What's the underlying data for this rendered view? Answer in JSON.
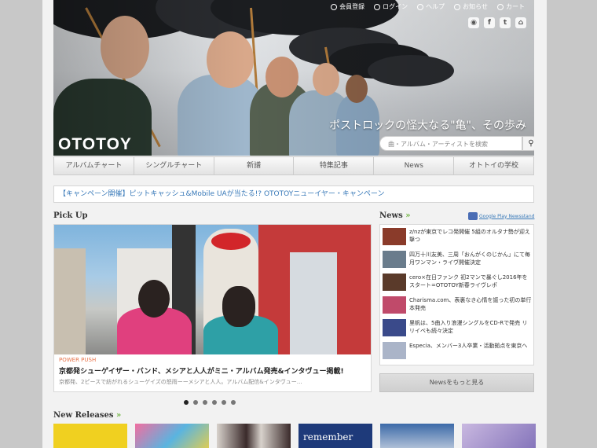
{
  "topnav": [
    {
      "label": "会員登録",
      "icon": "user-icon"
    },
    {
      "label": "ログイン",
      "icon": "login-icon"
    },
    {
      "label": "ヘルプ",
      "icon": "help-icon"
    },
    {
      "label": "お知らせ",
      "icon": "info-icon"
    },
    {
      "label": "カート",
      "icon": "cart-icon"
    }
  ],
  "social_icons": [
    "rss-icon",
    "facebook-icon",
    "twitter-icon",
    "home-icon"
  ],
  "hero": {
    "logo": "OTOTOY",
    "tagline": "ポストロックの怪大なる\"亀\"、その歩み",
    "search_placeholder": "曲・アルバム・アーティストを検索"
  },
  "mainnav": [
    "アルバムチャート",
    "シングルチャート",
    "新譜",
    "特集記事",
    "News",
    "オトトイの学校"
  ],
  "campaign": "【キャンペーン開催】ピットキャッシュ&Mobile UAが当たる!? OTOTOYニューイヤー・キャンペーン",
  "pickup": {
    "heading": "Pick Up",
    "label": "POWER PUSH",
    "title": "京都発シューゲイザー・バンド、メシアと人人がミニ・アルバム発売&インタヴュー掲載!",
    "desc": "京都発、2ピースで紡がれるシューゲイズの怒雨ーーメシアと人人。アルバム配信&インタヴュー…",
    "slides": 6,
    "active_slide": 1
  },
  "news": {
    "heading": "News",
    "badge": "Google Play Newsstand",
    "more": "Newsをもっと見る",
    "items": [
      {
        "text": "z/nzが東京でレコ発開催 5組のオルタナ勢が迎え撃つ",
        "color": "#8a3b2a"
      },
      {
        "text": "四万十川友美、三周「おんがくのじかん」にて毎月ワンマン・ライヴ開催決定",
        "color": "#6a7c8c"
      },
      {
        "text": "cero×在日ファンク 初2マンで暴ぐし2016年をスタート=OTOTOY新春ライヴレポ",
        "color": "#5a3a2a"
      },
      {
        "text": "Charisma.com、表裏なき心情を謳った初の単行本発売",
        "color": "#c04a6a"
      },
      {
        "text": "里帆は、5曲入り浪漫シングルをCD-Rで発売 リリイベも続々決定",
        "color": "#3a4a8a"
      },
      {
        "text": "Especia、メンバー3人卒業・活動拠点を東京へ",
        "color": "#aab4c8"
      }
    ]
  },
  "releases": {
    "heading": "New Releases",
    "thumbs": [
      {
        "color": "#f0d020",
        "text": ""
      },
      {
        "color": "#f26ea0",
        "text": ""
      },
      {
        "color": "#d8d2cc",
        "text": ""
      },
      {
        "color": "#1e3a7a",
        "text": "remember"
      },
      {
        "color": "#3c6aa8",
        "text": ""
      },
      {
        "color": "#c9b8e0",
        "text": ""
      }
    ]
  }
}
